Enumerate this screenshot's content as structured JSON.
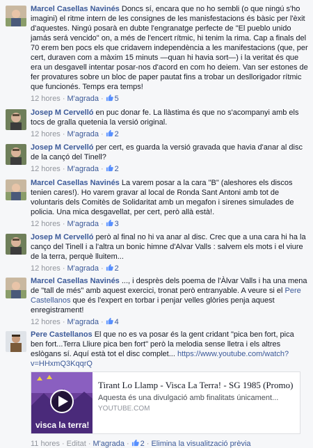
{
  "comments": [
    {
      "author": "Marcel Casellas Navinés",
      "text": "Doncs sí, encara que no ho sembli (o que ningú s'ho imagini) el ritme intern de les consignes de les manisfestacions és bàsic per l'èxit d'aquestes. Ningú posarà en dubte l'engranatge perfecte de \"El pueblo unido jamás será vencido\" on, a més de l'encert rítmic, hi tenim la rima. Cap a finals del 70 erem ben pocs els que cridavem independència a les manifestacions (que, per cert, duraven com a màxim 15 minuts —quan hi havia sort—) i la veritat és que era un desgavell intentar posar-nos d'acord en com ho deiem. Van ser estones de fer provatures sobre un bloc de paper pautat fins a trobar un desllorigador rítmic que funcionés. Temps era temps!",
      "time": "12 hores",
      "like_label": "M'agrada",
      "likes": "5"
    },
    {
      "author": "Josep M Cervelló",
      "text": "en puc donar fe. La llàstima és que no s'acompanyi amb els tocs de gralla quetenia la versió original.",
      "time": "12 hores",
      "like_label": "M'agrada",
      "likes": "2"
    },
    {
      "author": "Josep M Cervelló",
      "text": "per cert, es guarda la versió gravada que havia d'anar al disc de la cançó del Tinell?",
      "time": "12 hores",
      "like_label": "M'agrada",
      "likes": "2"
    },
    {
      "author": "Marcel Casellas Navinés",
      "text": "La varem posar a la cara \"B\" (aleshores els discos tenien cares!). Ho varem gravar al local de Ronda Sant Antoni amb tot de voluntaris dels Comitès de Solidaritat amb un megafon i sirenes simulades de policia. Una mica desgavellat, per cert, però allà està!.",
      "time": "12 hores",
      "like_label": "M'agrada",
      "likes": "3"
    },
    {
      "author": "Josep M Cervelló",
      "text": "però al final no hi va anar al disc. Crec que a una cara hi ha la canço del Tinell i a l'altra un bonic himne d'Alvar Valls : salvem els mots i el viure de la terra, perquè lluitem...",
      "time": "12 hores",
      "like_label": "M'agrada",
      "likes": "2"
    },
    {
      "author": "Marcel Casellas Navinés",
      "text_before": "..., i desprès dels poema de l'Àlvar Valls i ha una mena de \"tall de més\" amb aquest exercici, tronat però entranyable. A veure si el ",
      "mention": "Pere Castellanos",
      "text_after": " que és l'expert en torbar i penjar velles glòries penja aquest enregistrament!",
      "time": "12 hores",
      "like_label": "M'agrada",
      "likes": "4"
    },
    {
      "author": "Pere Castellanos",
      "text": "El que no es va posar és la gent cridant \"pica ben fort, pica ben fort...Terra Lliure pica ben fort\" però la melodia sense lletra i els altres eslògans sí. Aquí està tot el disc complet... ",
      "url": "https://www.youtube.com/watch?v=HHxmQ3KqqrQ",
      "time": "11 hores",
      "edited": "Editat",
      "like_label": "M'agrada",
      "likes": "2",
      "remove_preview": "Elimina la visualització prèvia"
    }
  ],
  "preview": {
    "title": "Tirant Lo Llamp - Visca La Terra! - SG 1985 (Promo)",
    "description": "Aquesta és una divulgació amb finalitats únicament...",
    "domain": "youtube.com",
    "thumb_caption": "visca la terra!"
  },
  "colors": {
    "link": "#3b5998",
    "meta": "#90949c",
    "like_badge": "#5890ff"
  }
}
